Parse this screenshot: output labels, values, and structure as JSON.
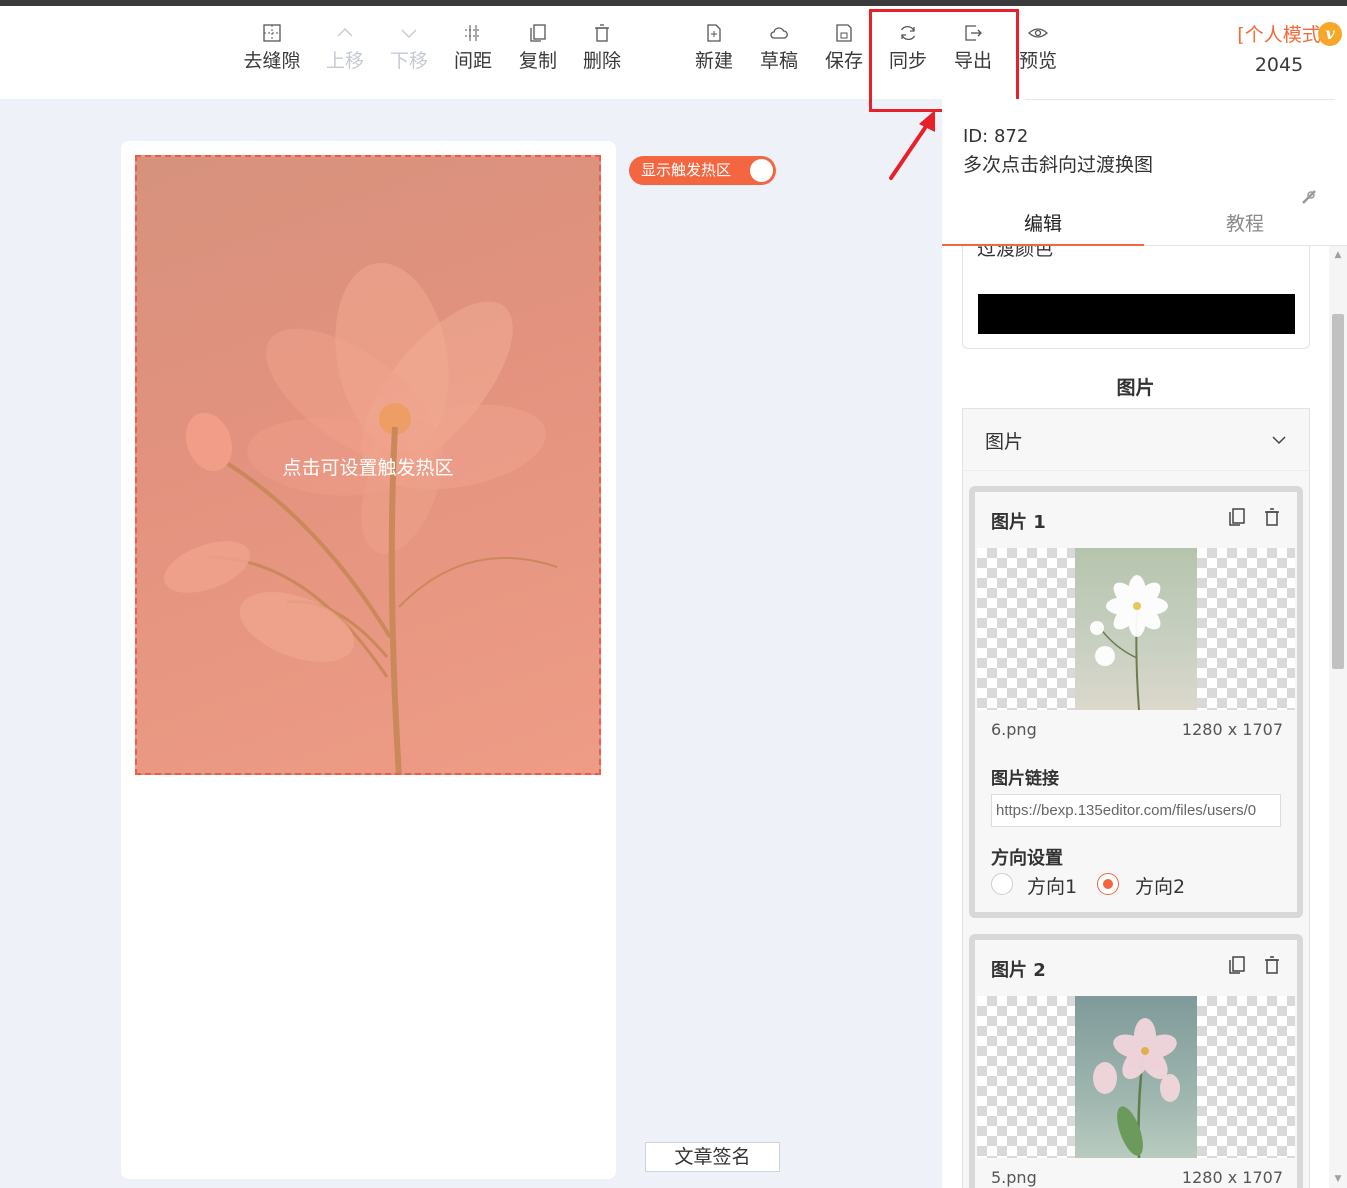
{
  "toolbar": {
    "items": [
      {
        "label": "去缝隙",
        "icon": "grid-dotted-icon",
        "enabled": true
      },
      {
        "label": "上移",
        "icon": "chevron-up-icon",
        "enabled": false
      },
      {
        "label": "下移",
        "icon": "chevron-down-icon",
        "enabled": false
      },
      {
        "label": "间距",
        "icon": "spacing-icon",
        "enabled": true
      },
      {
        "label": "复制",
        "icon": "copy-icon",
        "enabled": true
      },
      {
        "label": "删除",
        "icon": "trash-icon",
        "enabled": true
      },
      {
        "label": "新建",
        "icon": "new-file-icon",
        "enabled": true
      },
      {
        "label": "草稿",
        "icon": "cloud-icon",
        "enabled": true
      },
      {
        "label": "保存",
        "icon": "save-icon",
        "enabled": true
      },
      {
        "label": "同步",
        "icon": "sync-icon",
        "enabled": true
      },
      {
        "label": "导出",
        "icon": "export-icon",
        "enabled": true
      },
      {
        "label": "预览",
        "icon": "eye-icon",
        "enabled": true
      }
    ],
    "mode_label": "[个人模式",
    "mode_badge": "v",
    "mode_number": "2045"
  },
  "canvas": {
    "hotzone_text": "点击可设置触发热区",
    "toggle_label": "显示触发热区",
    "toggle_on": true,
    "signature_button": "文章签名"
  },
  "panel": {
    "id_text": "ID: 872",
    "template_name": "多次点击斜向过渡换图",
    "tabs": [
      {
        "label": "编辑",
        "active": true
      },
      {
        "label": "教程",
        "active": false
      }
    ],
    "transition_color_label": "过渡颜色",
    "transition_color": "#000000",
    "section_title": "图片",
    "group_title": "图片",
    "images": [
      {
        "title": "图片 1",
        "file": "6.png",
        "size": "1280 x 1707",
        "link_label": "图片链接",
        "link_value": "https://bexp.135editor.com/files/users/0",
        "direction_label": "方向设置",
        "options": [
          "方向1",
          "方向2"
        ],
        "selected": 1
      },
      {
        "title": "图片 2",
        "file": "5.png",
        "size": "1280 x 1707"
      }
    ]
  },
  "colors": {
    "accent": "#f36640",
    "highlight": "#e8202a",
    "mode": "#f36b3b"
  }
}
